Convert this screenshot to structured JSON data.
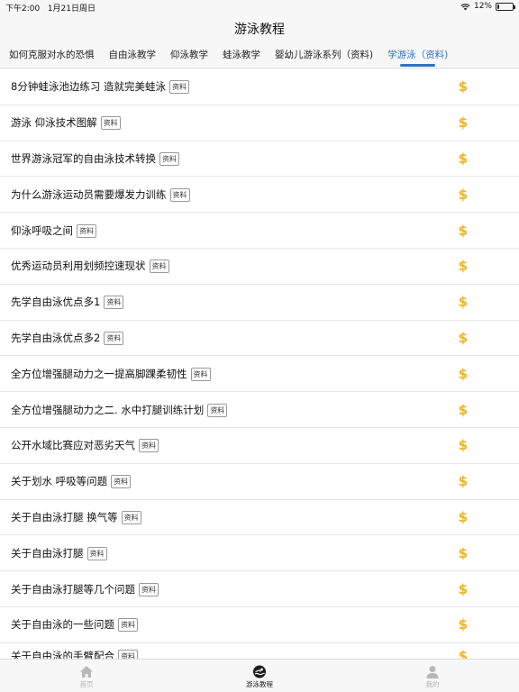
{
  "status_bar": {
    "time": "下午2:00",
    "date": "1月21日周日",
    "battery_text": "12%",
    "battery_level": 0.12
  },
  "nav": {
    "title": "游泳教程"
  },
  "tabs": [
    {
      "label": "如何克服对水的恐惧",
      "active": false
    },
    {
      "label": "自由泳教学",
      "active": false
    },
    {
      "label": "仰泳教学",
      "active": false
    },
    {
      "label": "蛙泳教学",
      "active": false
    },
    {
      "label": "婴幼儿游泳系列（资料)",
      "active": false
    },
    {
      "label": "学游泳（资料)",
      "active": true
    }
  ],
  "list": {
    "badge_label": "资料",
    "price_icon": "$",
    "price_color": "#f0b323",
    "items": [
      {
        "title": "8分钟蛙泳池边练习 造就完美蛙泳"
      },
      {
        "title": "游泳 仰泳技术图解"
      },
      {
        "title": "世界游泳冠军的自由泳技术转换"
      },
      {
        "title": "为什么游泳运动员需要爆发力训练"
      },
      {
        "title": "仰泳呼吸之间"
      },
      {
        "title": "优秀运动员利用划频控速现状"
      },
      {
        "title": "先学自由泳优点多1"
      },
      {
        "title": "先学自由泳优点多2"
      },
      {
        "title": "全方位增强腿动力之一提高脚踝柔韧性"
      },
      {
        "title": "全方位增强腿动力之二. 水中打腿训练计划"
      },
      {
        "title": "公开水域比赛应对恶劣天气"
      },
      {
        "title": "关于划水 呼吸等问题"
      },
      {
        "title": "关于自由泳打腿 换气等"
      },
      {
        "title": "关于自由泳打腿"
      },
      {
        "title": "关于自由泳打腿等几个问题"
      },
      {
        "title": "关于自由泳的一些问题"
      },
      {
        "title": "关于自由泳的手臂配合"
      }
    ]
  },
  "tabbar": {
    "items": [
      {
        "label": "首页",
        "icon": "home-icon",
        "active": false
      },
      {
        "label": "游泳教程",
        "icon": "swimmer-icon",
        "active": true
      },
      {
        "label": "我的",
        "icon": "person-icon",
        "active": false
      }
    ]
  },
  "colors": {
    "accent": "#2f73c8",
    "price": "#f0b323"
  }
}
